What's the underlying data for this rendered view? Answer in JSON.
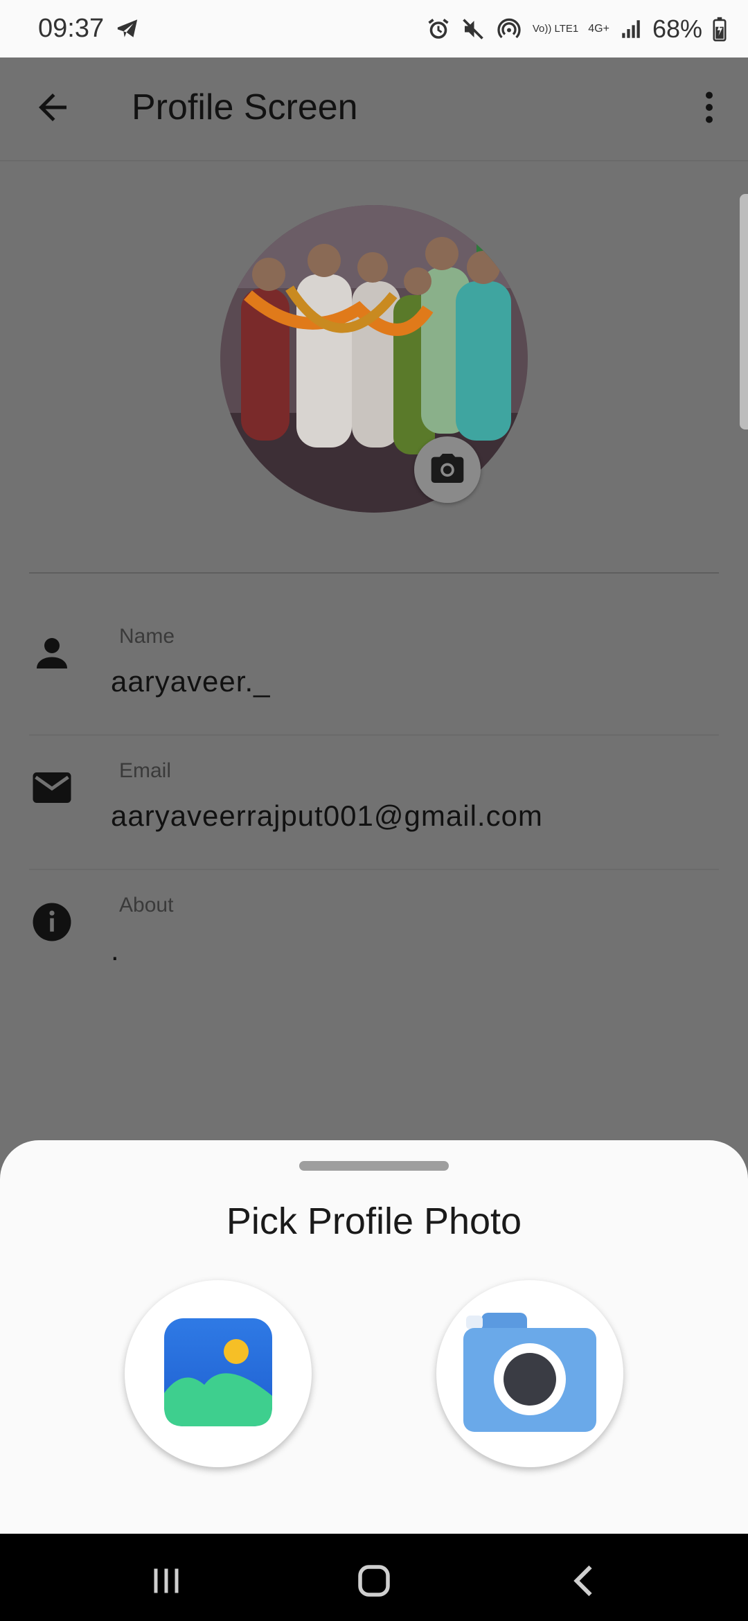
{
  "status_bar": {
    "time": "09:37",
    "battery_percent": "68%",
    "network_label_volte": "Vo)) LTE1",
    "network_label_4g": "4G+",
    "icons": [
      "telegram-icon",
      "alarm-icon",
      "mute-icon",
      "hotspot-icon",
      "signal-icon",
      "battery-charging-icon"
    ]
  },
  "app_bar": {
    "title": "Profile Screen",
    "icons": [
      "back-arrow-icon",
      "more-vert-icon"
    ]
  },
  "profile": {
    "fields": [
      {
        "label": "Name",
        "value": "aaryaveer._",
        "icon": "person-icon"
      },
      {
        "label": "Email",
        "value": "aaryaveerrajput001@gmail.com",
        "icon": "email-icon"
      },
      {
        "label": "About",
        "value": ".",
        "icon": "info-icon"
      }
    ]
  },
  "bottom_sheet": {
    "title": "Pick Profile Photo",
    "options": [
      "gallery-icon",
      "camera-icon"
    ]
  },
  "colors": {
    "scrim": "#727272",
    "sheet_bg": "#fafafa",
    "camera_blue": "#6aa9e9",
    "gallery_blue": "#2f7ae5",
    "gallery_green": "#3ecf8e",
    "sun_yellow": "#f6bf26"
  }
}
